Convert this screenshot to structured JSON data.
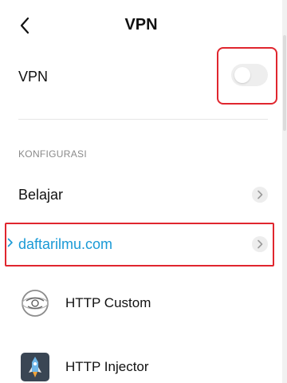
{
  "header": {
    "back_icon": "chevron-left-icon",
    "title": "VPN"
  },
  "vpn_toggle": {
    "label": "VPN",
    "enabled": false
  },
  "config_section": {
    "title": "KONFIGURASI",
    "items": [
      {
        "label": "Belajar",
        "icon": "chevron-right-icon"
      },
      {
        "label": "daftarilmu.com",
        "icon": "chevron-right-icon",
        "selected": true
      }
    ]
  },
  "apps": [
    {
      "label": "HTTP Custom",
      "icon": "http-custom-icon"
    },
    {
      "label": "HTTP Injector",
      "icon": "http-injector-icon"
    }
  ],
  "colors": {
    "accent": "#1a9ad6",
    "highlight": "#e0262e",
    "toggle_off": "#eeeeee"
  }
}
